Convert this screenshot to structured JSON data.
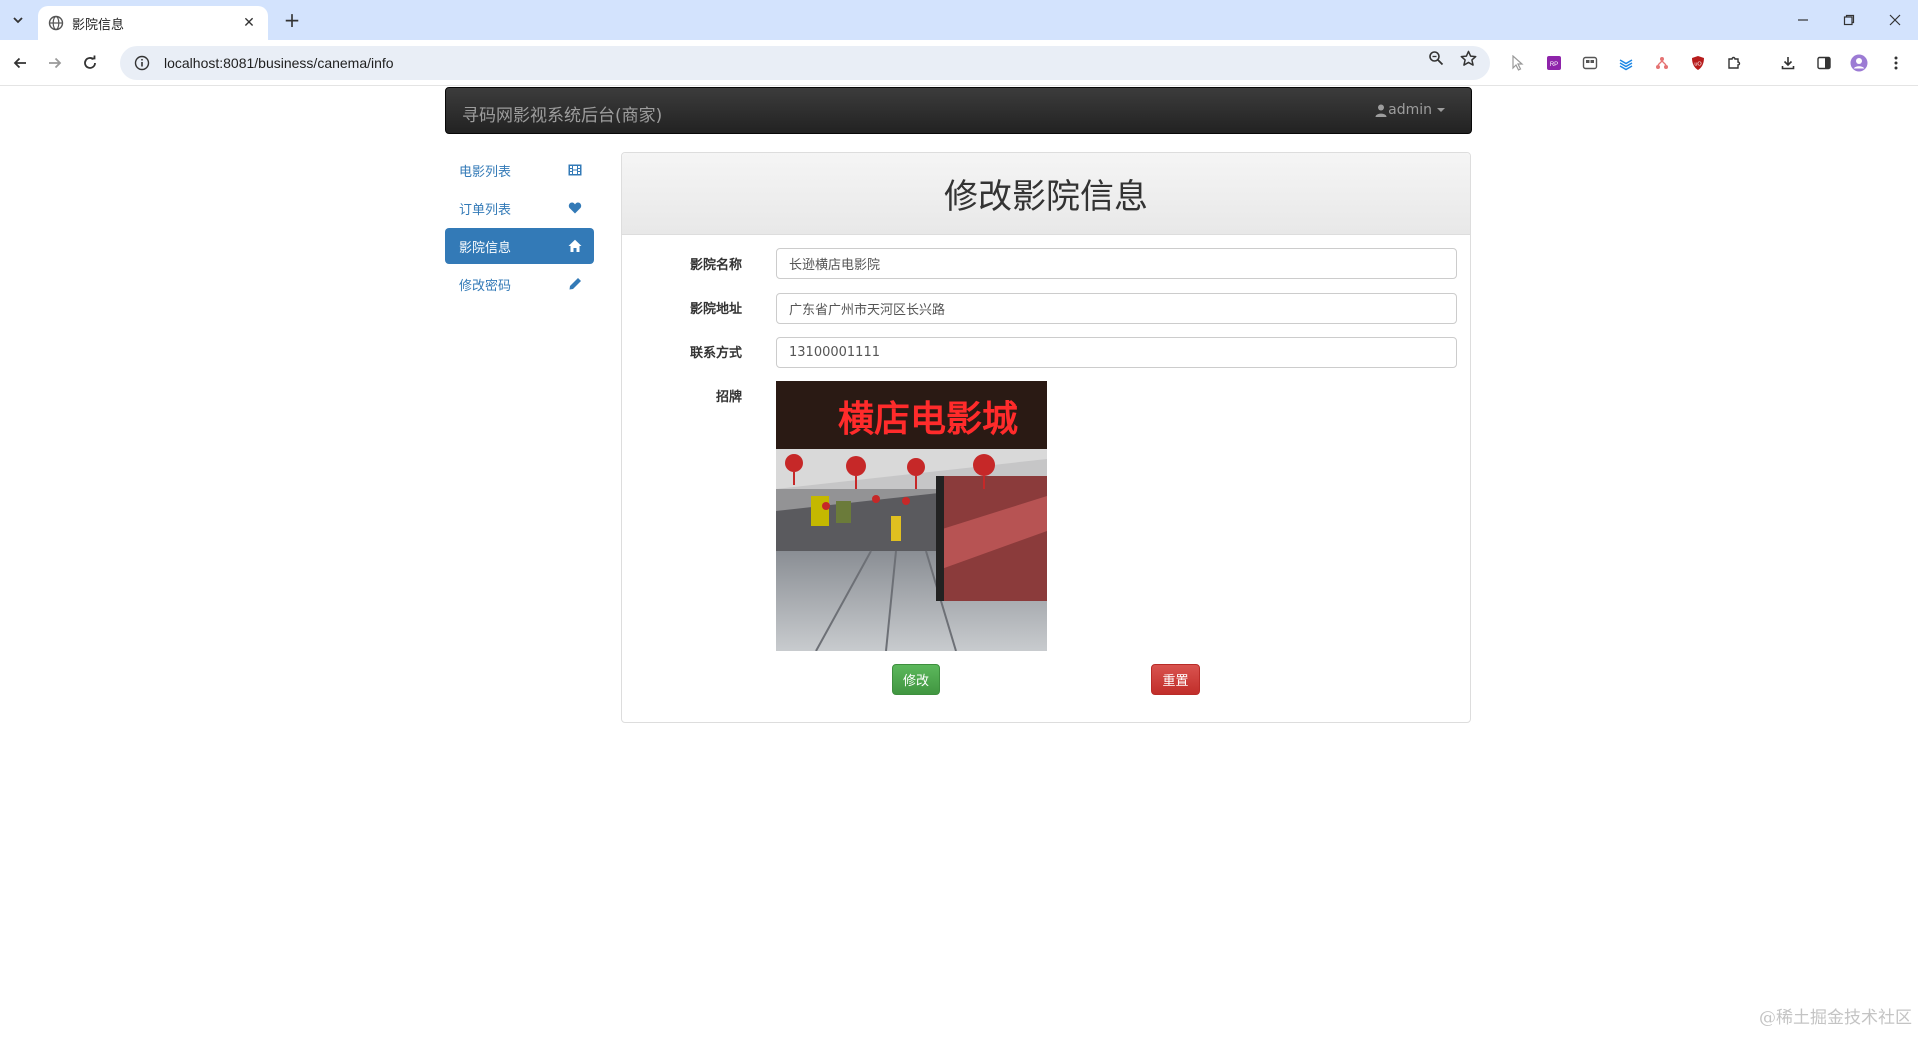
{
  "browser": {
    "tab_title": "影院信息",
    "new_tab_label": "+",
    "url": "localhost:8081/business/canema/info",
    "window_controls": [
      "minimize-icon",
      "restore-icon",
      "close-icon"
    ]
  },
  "navbar": {
    "brand": "寻码网影视系统后台(商家)",
    "user": "admin"
  },
  "sidebar": {
    "items": [
      {
        "label": "电影列表",
        "icon": "film-icon",
        "active": false
      },
      {
        "label": "订单列表",
        "icon": "heart-icon",
        "active": false
      },
      {
        "label": "影院信息",
        "icon": "home-icon",
        "active": true
      },
      {
        "label": "修改密码",
        "icon": "pencil-icon",
        "active": false
      }
    ]
  },
  "panel": {
    "title": "修改影院信息"
  },
  "form": {
    "name_label": "影院名称",
    "name_value": "长逊横店电影院",
    "address_label": "影院地址",
    "address_value": "广东省广州市天河区长兴路",
    "phone_label": "联系方式",
    "phone_value": "13100001111",
    "sign_label": "招牌",
    "sign_text": "横店电影城",
    "submit_label": "修改",
    "reset_label": "重置"
  },
  "watermark": "@稀土掘金技术社区",
  "colors": {
    "tabbar": "#d3e3fd",
    "navbar": "#222222",
    "primary": "#337ab7",
    "success": "#5cb85c",
    "danger": "#d9534f"
  }
}
